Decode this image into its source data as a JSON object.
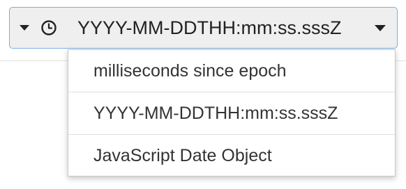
{
  "format_select": {
    "selected_value": "YYYY-MM-DDTHH:mm:ss.sssZ",
    "leading_icon": "clock-icon",
    "toggle_icon": "caret-down-icon",
    "trailing_icon": "chevron-down-icon"
  },
  "dropdown": {
    "options": [
      {
        "label": "milliseconds since epoch"
      },
      {
        "label": "YYYY-MM-DDTHH:mm:ss.sssZ"
      },
      {
        "label": "JavaScript Date Object"
      }
    ]
  },
  "colors": {
    "select_background": "#efefef",
    "select_border": "#7aaee4",
    "text": "#222222"
  }
}
